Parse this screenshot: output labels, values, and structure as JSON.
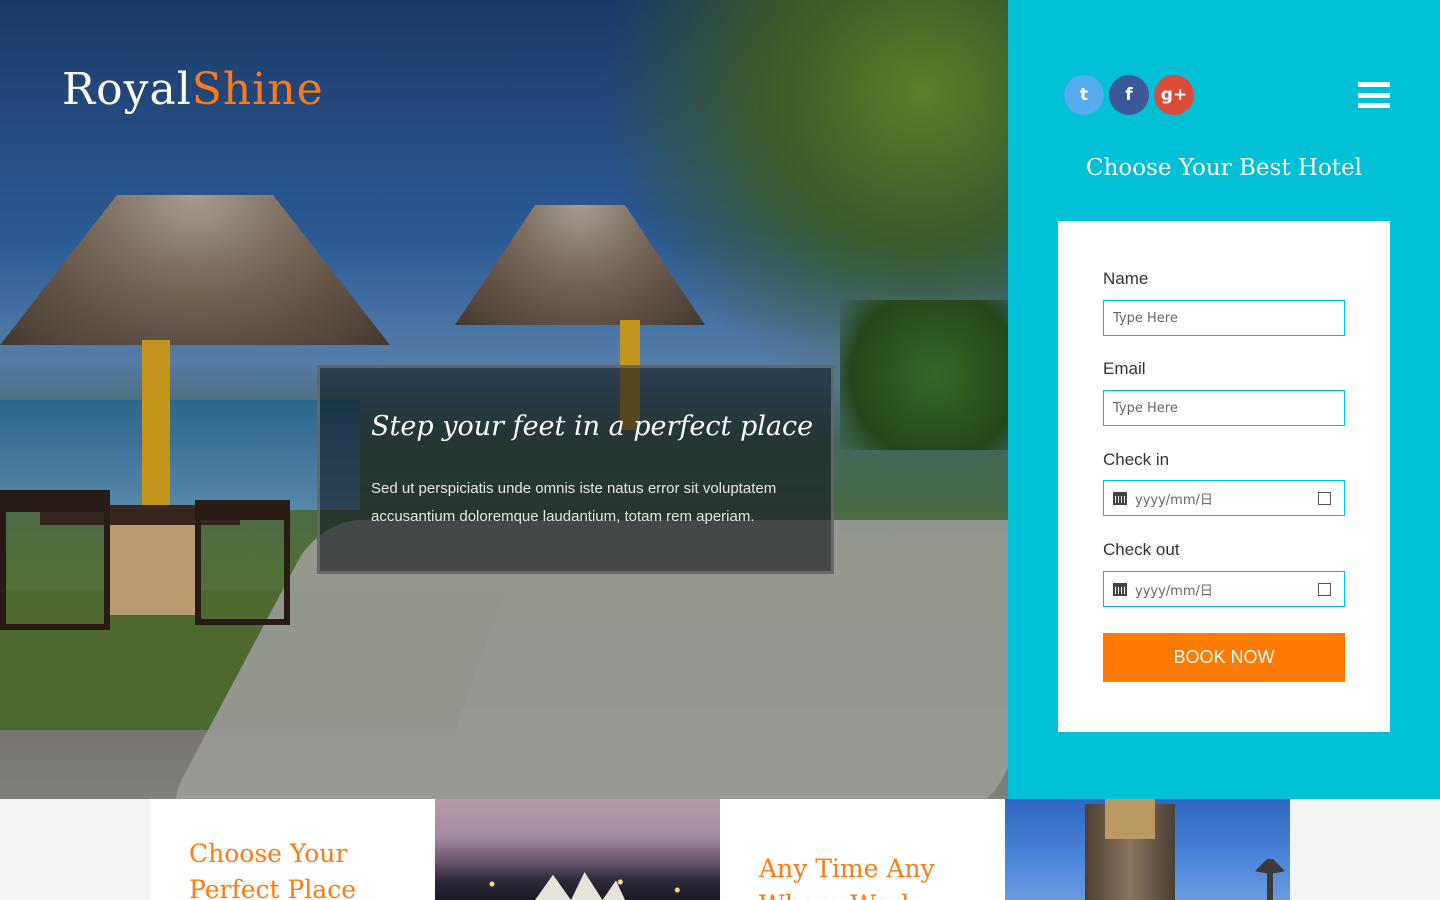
{
  "brand": {
    "part1": "Royal",
    "part2": "Shine",
    "accent_color": "#ff7a12"
  },
  "hero": {
    "title": "Step your feet in a perfect place",
    "text": "Sed ut perspiciatis unde omnis iste natus error sit voluptatem accusantium doloremque laudantium, totam rem aperiam."
  },
  "social": [
    {
      "icon": "twitter-icon",
      "glyph": "t",
      "color": "#55acee"
    },
    {
      "icon": "facebook-icon",
      "glyph": "f",
      "color": "#3b5998"
    },
    {
      "icon": "google-plus-icon",
      "glyph": "g+",
      "color": "#dd4b39"
    }
  ],
  "panel": {
    "title": "Choose Your Best Hotel",
    "bg_color": "#00c0d6"
  },
  "form": {
    "name_label": "Name",
    "name_placeholder": "Type Here",
    "email_label": "Email",
    "email_placeholder": "Type Here",
    "checkin_label": "Check in",
    "checkin_placeholder": "yyyy/mm/日",
    "checkout_label": "Check out",
    "checkout_placeholder": "yyyy/mm/日",
    "button_label": "BOOK NOW",
    "button_color": "#ff7a00"
  },
  "features": [
    {
      "title": "Choose Your Perfect Place"
    },
    {
      "title": "Any Time Any Where Work"
    }
  ]
}
